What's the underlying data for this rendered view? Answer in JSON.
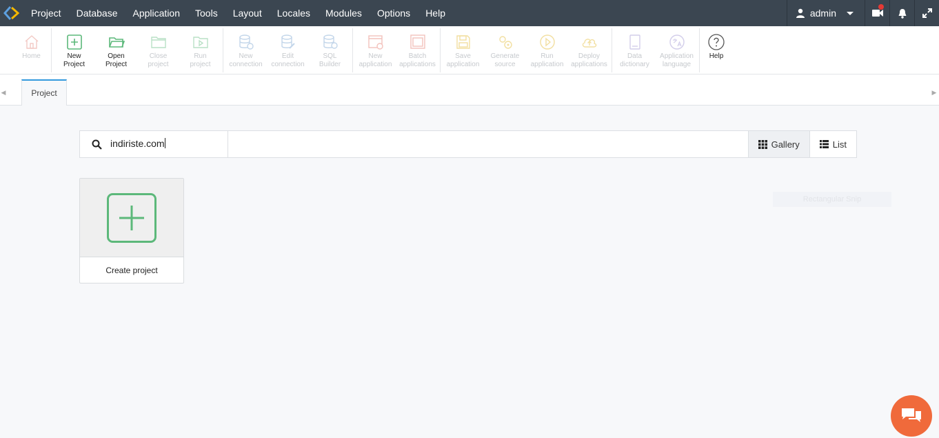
{
  "menu": {
    "items": [
      "Project",
      "Database",
      "Application",
      "Tools",
      "Layout",
      "Locales",
      "Modules",
      "Options",
      "Help"
    ],
    "user": "admin"
  },
  "toolbar": {
    "home": "Home",
    "new_project": "New\nProject",
    "open_project": "Open\nProject",
    "close_project": "Close\nproject",
    "run_project": "Run\nproject",
    "new_connection": "New\nconnection",
    "edit_connection": "Edit\nconnection",
    "sql_builder": "SQL\nBuilder",
    "new_application": "New\napplication",
    "batch_applications": "Batch\napplications",
    "save_application": "Save\napplication",
    "generate_source": "Generate\nsource",
    "run_application": "Run\napplication",
    "deploy_applications": "Deploy\napplications",
    "data_dictionary": "Data\ndictionary",
    "application_language": "Application\nlanguage",
    "help": "Help"
  },
  "tabs": [
    {
      "label": "Project"
    }
  ],
  "search": {
    "value": "indiriste.com"
  },
  "views": {
    "gallery": "Gallery",
    "list": "List"
  },
  "card": {
    "label": "Create project"
  },
  "overlay": {
    "snip": "Rectangular Snip"
  },
  "colors": {
    "menubar": "#3b4651",
    "green_accent": "#5cb87a",
    "tab_accent": "#3399dd",
    "chat": "#f06a3b"
  }
}
